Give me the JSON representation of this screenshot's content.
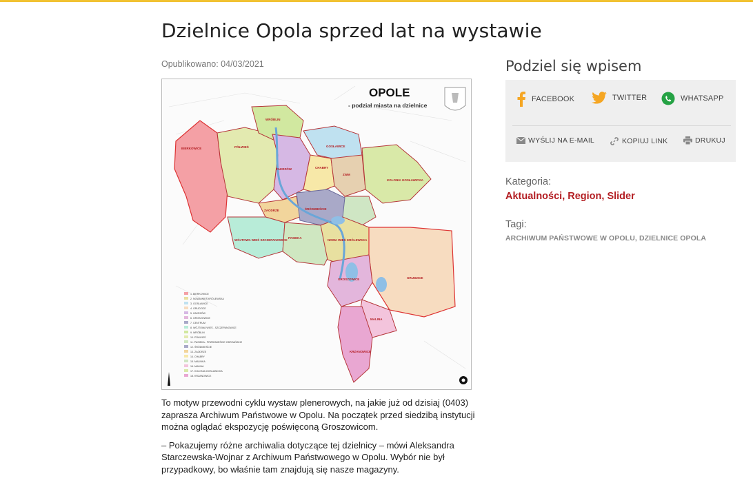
{
  "page": {
    "title": "Dzielnice Opola sprzed lat na wystawie",
    "published": "Opublikowano: 04/03/2021"
  },
  "map": {
    "heading": "OPOLE",
    "subheading": "- podział miasta na dzielnice",
    "labels": [
      "BIERKOWICE",
      "PÓŁWIEŚ",
      "WRÓBLIN",
      "GOSŁAWICE",
      "CHABRY",
      "ZAKRZÓW",
      "ZAODRZE",
      "ŚRÓDMIEŚCIE",
      "ZWM",
      "KOLONIA GOSŁAWICKA",
      "PASIEKA",
      "NOWA WIEŚ KRÓLEWSKA",
      "WÓJTOWA WIEŚ SZCZEPANOWICE",
      "GRUDZICE",
      "GROSZOWICE",
      "MALINA",
      "KRZANOWICE",
      "NOWA WIEŚ KRÓLEWSKA"
    ],
    "legend": [
      "1. BIERKOWICE",
      "2. NOWA WIEŚ KRÓLEWSKA",
      "3. GOSŁAWICE",
      "4. GRUDZICE",
      "5. ZAKRZÓW",
      "6. GROSZOWICE",
      "7. CENTRUM",
      "8. WÓJTOWA WIEŚ - SZCZEPANOWICE",
      "9. WRÓBLIN",
      "10. PÓŁWIEŚ",
      "11. PASIEKA - PRZEDMIEŚCIE ODRZAŃSKIE",
      "12. ŚRÓDMIEŚCIE",
      "13. ZAODRZE",
      "14. CHABRY",
      "15. MALINKA",
      "16. MALINA",
      "17. KOLONIA GOSŁAWICKA",
      "18. KRZANOWICE"
    ]
  },
  "article": {
    "paragraphs": [
      " To motyw przewodni cyklu wystaw plenerowych, na jakie już od dzisiaj (0403) zaprasza Archiwum Państwowe w Opolu. Na początek przed siedzibą instytucji można oglądać ekspozycję poświęconą Groszowicom.",
      "– Pokazujemy różne archiwalia dotyczące tej dzielnicy – mówi Aleksandra Starczewska-Wojnar z Archiwum Państwowego w Opolu. Wybór nie był przypadkowy,  bo właśnie tam znajdują się nasze magazyny."
    ]
  },
  "share": {
    "title": "Podziel się wpisem",
    "facebook": "FACEBOOK",
    "twitter": "TWITTER",
    "whatsapp": "WHATSAPP",
    "email": "WYŚLIJ NA E-MAIL",
    "copy": "KOPIUJ LINK",
    "print": "DRUKUJ"
  },
  "category": {
    "label": "Kategoria:",
    "items": [
      "Aktualności",
      "Region",
      "Slider"
    ],
    "sep": ", "
  },
  "tags": {
    "label": "Tagi:",
    "items": [
      "ARCHIWUM PAŃSTWOWE W OPOLU",
      "DZIELNICE OPOLA"
    ],
    "sep": ", "
  },
  "colors": {
    "accent": "#b31d22",
    "facebook": "#f5a623",
    "twitter": "#f5a623",
    "whatsapp": "#25a244",
    "topbar": "#f1c232"
  }
}
